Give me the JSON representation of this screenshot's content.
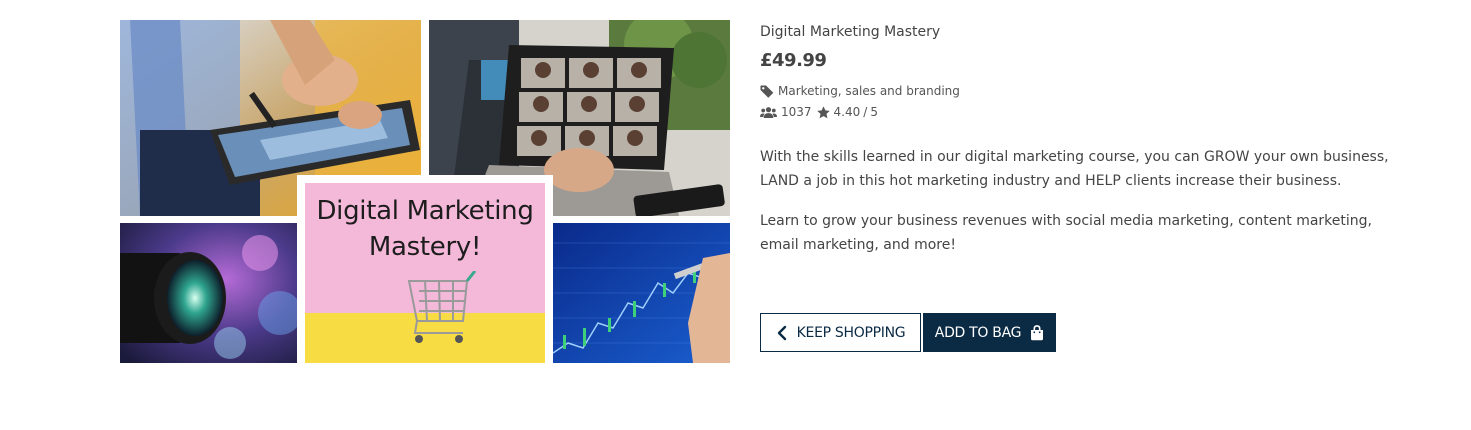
{
  "product": {
    "name": "Digital Marketing Mastery",
    "price": "£49.99",
    "category": "Marketing, sales and branding",
    "students": "1037",
    "rating": "4.40",
    "rating_max": "5",
    "description": [
      "With the skills learned in our digital marketing course, you can GROW your own business, LAND a job in this hot marketing industry and HELP clients increase their business.",
      "Learn to grow your business revenues with social media marketing, content marketing, email marketing, and more!"
    ]
  },
  "image": {
    "caption": "Digital Marketing\nMastery!"
  },
  "buttons": {
    "keep_shopping": "Keep Shopping",
    "add_to_bag": "Add to Bag"
  },
  "icons": {
    "category": "tag-icon",
    "students": "users-icon",
    "rating": "star-icon",
    "keep_shopping": "chevron-left-icon",
    "add_to_bag": "shopping-bag-icon"
  },
  "colors": {
    "primary": "#0b2a44",
    "text": "#444444",
    "caption_pink": "#f4b8d9",
    "caption_yellow": "#f7dc44"
  }
}
